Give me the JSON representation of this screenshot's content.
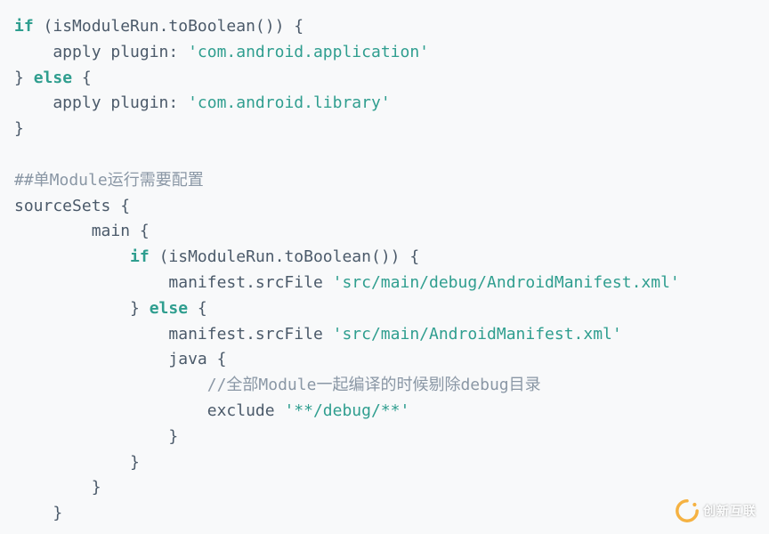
{
  "code": {
    "l1_a": "if",
    "l1_b": " (isModuleRun.toBoolean()) {",
    "l2_a": "    apply plugin: ",
    "l2_b": "'com.android.application'",
    "l3_a": "} ",
    "l3_b": "else",
    "l3_c": " {",
    "l4_a": "    apply plugin: ",
    "l4_b": "'com.android.library'",
    "l5_a": "}",
    "l6_a": "",
    "l7_a": "##单Module运行需要配置",
    "l8_a": "sourceSets {",
    "l9_a": "        main {",
    "l10_a": "            ",
    "l10_b": "if",
    "l10_c": " (isModuleRun.toBoolean()) {",
    "l11_a": "                manifest.srcFile ",
    "l11_b": "'src/main/debug/AndroidManifest.xml'",
    "l12_a": "            } ",
    "l12_b": "else",
    "l12_c": " {",
    "l13_a": "                manifest.srcFile ",
    "l13_b": "'src/main/AndroidManifest.xml'",
    "l14_a": "                java {",
    "l15_a": "                    ",
    "l15_b": "//全部Module一起编译的时候剔除debug目录",
    "l16_a": "                    exclude ",
    "l16_b": "'**/debug/**'",
    "l17_a": "                }",
    "l18_a": "            }",
    "l19_a": "        }",
    "l20_a": "    }"
  },
  "watermark": {
    "text": "创新互联"
  }
}
